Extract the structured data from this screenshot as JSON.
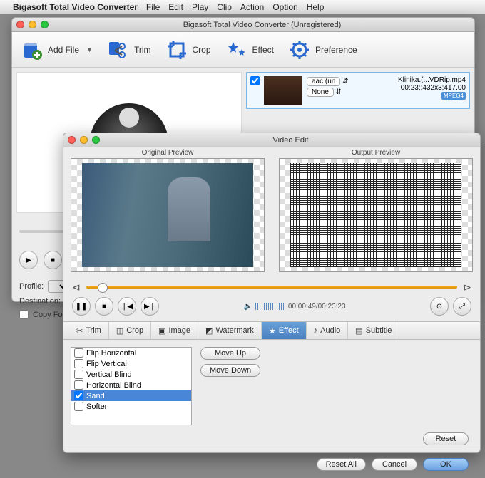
{
  "menubar": {
    "app": "Bigasoft Total Video Converter",
    "items": [
      "File",
      "Edit",
      "Play",
      "Clip",
      "Action",
      "Option",
      "Help"
    ]
  },
  "mainwin": {
    "title": "Bigasoft Total Video Converter (Unregistered)",
    "toolbar": {
      "addfile": "Add File",
      "trim": "Trim",
      "crop": "Crop",
      "effect": "Effect",
      "preference": "Preference"
    },
    "file": {
      "name": "Klinika.(...VDRip.mp4",
      "audio_sel": "aac (un",
      "sub_sel": "None",
      "duration": "00:23;:432x3;417.00",
      "badge": "MPEG4"
    },
    "profile_label": "Profile:",
    "destination_label": "Destination:",
    "destination_value": "/",
    "copy_folder": "Copy Folder S"
  },
  "editwin": {
    "title": "Video Edit",
    "orig_label": "Original Preview",
    "out_label": "Output Preview",
    "time": "00:00:49/00:23:23",
    "tabs": {
      "trim": "Trim",
      "crop": "Crop",
      "image": "Image",
      "watermark": "Watermark",
      "effect": "Effect",
      "audio": "Audio",
      "subtitle": "Subtitle"
    },
    "effects": [
      "Flip Horizontal",
      "Flip Vertical",
      "Vertical Blind",
      "Horizontal Blind",
      "Sand",
      "Soften"
    ],
    "effects_checked": [
      false,
      false,
      false,
      false,
      true,
      false
    ],
    "effects_selected_index": 4,
    "moveup": "Move Up",
    "movedown": "Move Down",
    "reset": "Reset",
    "resetall": "Reset All",
    "cancel": "Cancel",
    "ok": "OK"
  }
}
